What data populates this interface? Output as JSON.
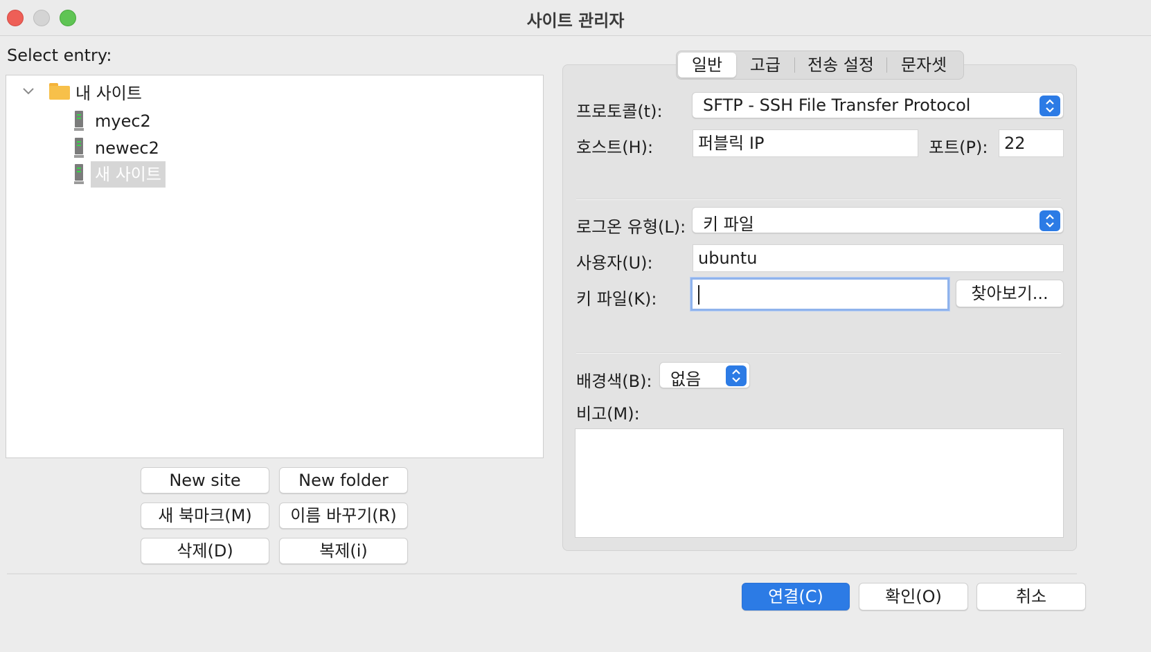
{
  "window": {
    "title": "사이트 관리자"
  },
  "left": {
    "select_label": "Select entry:",
    "tree": {
      "folder": "내 사이트",
      "sites": [
        "myec2",
        "newec2",
        "새 사이트"
      ],
      "selected_index": 2
    },
    "buttons": {
      "new_site": "New site",
      "new_folder": "New folder",
      "new_bookmark": "새 북마크(M)",
      "rename": "이름 바꾸기(R)",
      "delete": "삭제(D)",
      "duplicate": "복제(i)"
    }
  },
  "tabs": [
    "일반",
    "고급",
    "전송 설정",
    "문자셋"
  ],
  "active_tab": "일반",
  "general": {
    "protocol_label": "프로토콜(t):",
    "protocol_value": "SFTP - SSH File Transfer Protocol",
    "host_label": "호스트(H):",
    "host_value": "퍼블릭 IP",
    "port_label": "포트(P):",
    "port_value": "22",
    "logon_label": "로그온 유형(L):",
    "logon_value": "키 파일",
    "user_label": "사용자(U):",
    "user_value": "ubuntu",
    "keyfile_label": "키 파일(K):",
    "keyfile_value": "",
    "browse_button": "찾아보기...",
    "bgcolor_label": "배경색(B):",
    "bgcolor_value": "없음",
    "memo_label": "비고(M):",
    "memo_value": ""
  },
  "footer": {
    "connect": "연결(C)",
    "ok": "확인(O)",
    "cancel": "취소"
  },
  "colors": {
    "accent": "#2c7be5",
    "close": "#ee5f57",
    "maximize": "#5fc454",
    "folder": "#f7c04a",
    "server_led": "#39d44a"
  },
  "icons": [
    "chevron-down-icon",
    "folder-icon",
    "server-icon",
    "up-down-chevron-icon"
  ]
}
